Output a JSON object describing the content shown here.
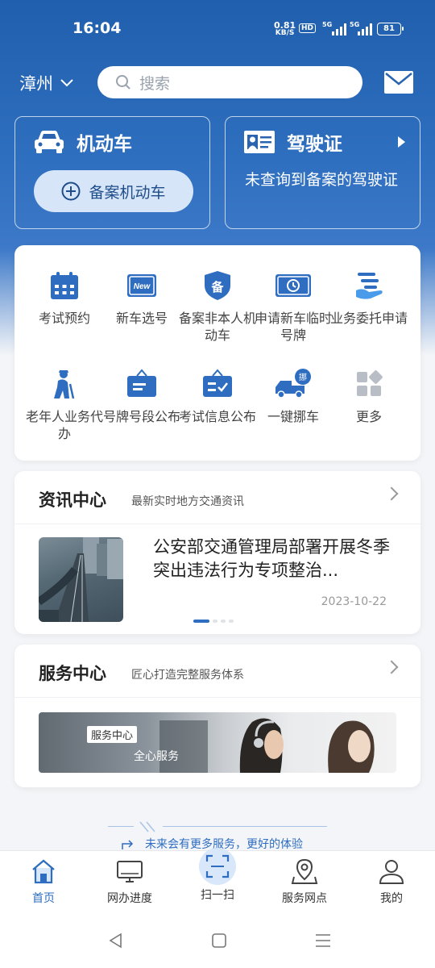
{
  "status": {
    "time": "16:04",
    "speed_value": "0.81",
    "speed_unit": "KB/S",
    "hd": "HD",
    "net1": "5G",
    "net2": "5G",
    "battery": "81"
  },
  "header": {
    "city": "漳州",
    "search_placeholder": "搜索"
  },
  "cards": {
    "vehicle": {
      "title": "机动车",
      "button": "备案机动车"
    },
    "license": {
      "title": "驾驶证",
      "message": "未查询到备案的驾驶证"
    }
  },
  "services": [
    {
      "label": "考试预约",
      "icon": "calendar-icon"
    },
    {
      "label": "新车选号",
      "icon": "new-plate-icon"
    },
    {
      "label": "备案非本人机动车",
      "icon": "shield-icon"
    },
    {
      "label": "申请新车临时号牌",
      "icon": "temp-plate-icon"
    },
    {
      "label": "业务委托申请",
      "icon": "delegate-hand-icon"
    },
    {
      "label": "老年人业务代办",
      "icon": "elderly-icon"
    },
    {
      "label": "号牌号段公布",
      "icon": "notice-board-icon"
    },
    {
      "label": "考试信息公布",
      "icon": "exam-board-icon"
    },
    {
      "label": "一键挪车",
      "icon": "tow-truck-icon"
    },
    {
      "label": "更多",
      "icon": "more-grid-icon"
    }
  ],
  "news": {
    "title": "资讯中心",
    "subtitle": "最新实时地方交通资讯",
    "item_title": "公安部交通管理局部署开展冬季突出违法行为专项整治...",
    "item_date": "2023-10-22"
  },
  "service_center": {
    "title": "服务中心",
    "subtitle": "匠心打造完整服务体系",
    "banner_tag": "服务中心",
    "banner_sub": "全心服务"
  },
  "footer_note": "未来会有更多服务，更好的体验",
  "tabs": [
    {
      "label": "首页",
      "icon": "home-icon",
      "active": true
    },
    {
      "label": "网办进度",
      "icon": "monitor-icon",
      "active": false
    },
    {
      "label": "扫一扫",
      "icon": "scan-icon",
      "active": false
    },
    {
      "label": "服务网点",
      "icon": "location-icon",
      "active": false
    },
    {
      "label": "我的",
      "icon": "user-icon",
      "active": false
    }
  ],
  "colors": {
    "primary": "#2e6dc0",
    "hero_top": "#1f5fad",
    "accent_light": "#d6e6f8"
  }
}
